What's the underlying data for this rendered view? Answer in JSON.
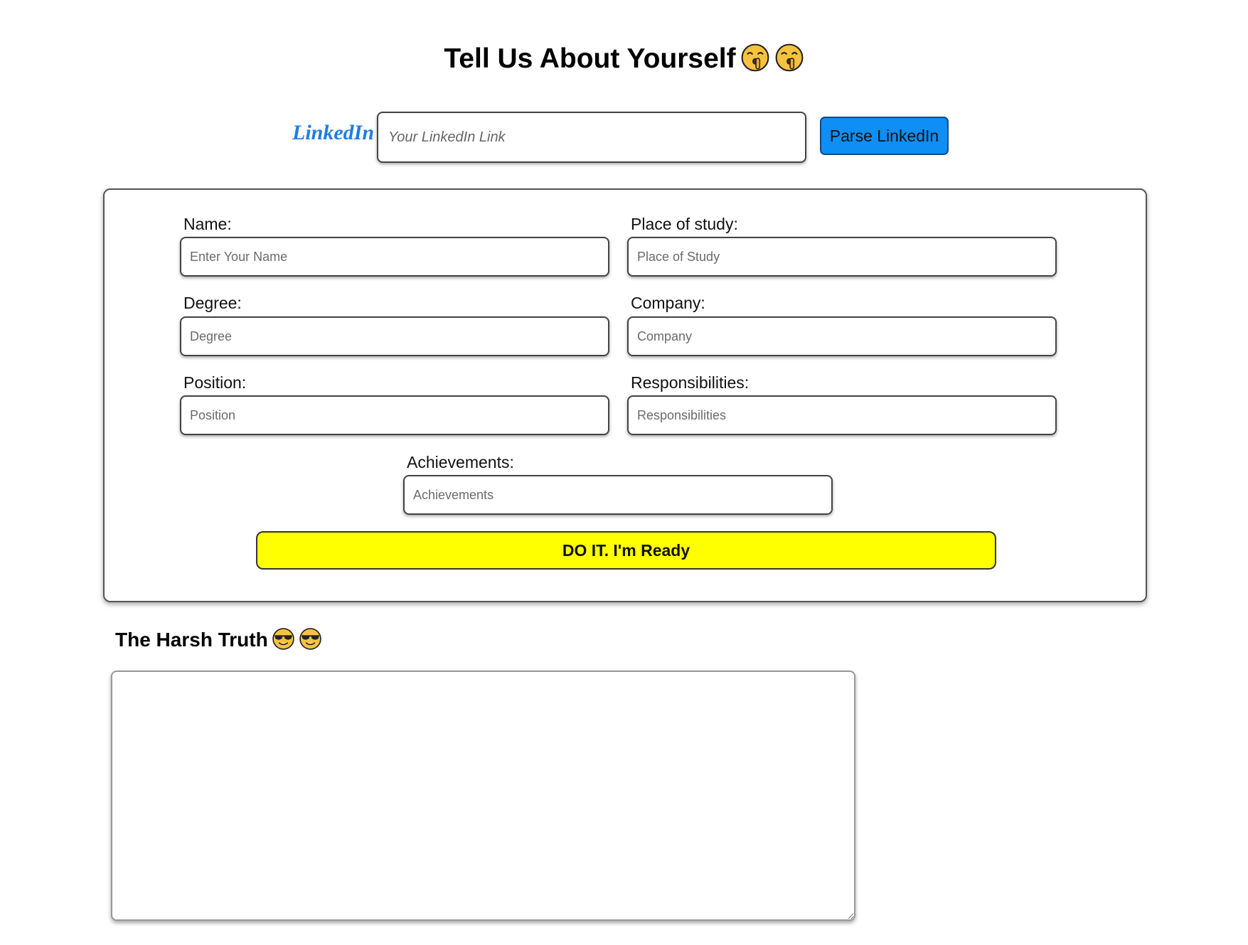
{
  "header": {
    "title": "Tell Us About Yourself",
    "title_emoji": "shushing-face-icon"
  },
  "linkedin": {
    "label": "LinkedIn",
    "placeholder": "Your LinkedIn Link",
    "value": "",
    "button_label": "Parse LinkedIn",
    "button_color": "#0f8ef5",
    "label_color": "#1e7ee0"
  },
  "form": {
    "fields": {
      "name": {
        "label": "Name:",
        "placeholder": "Enter Your Name",
        "value": ""
      },
      "place_of_study": {
        "label": "Place of study:",
        "placeholder": "Place of Study",
        "value": ""
      },
      "degree": {
        "label": "Degree:",
        "placeholder": "Degree",
        "value": ""
      },
      "company": {
        "label": "Company:",
        "placeholder": "Company",
        "value": ""
      },
      "position": {
        "label": "Position:",
        "placeholder": "Position",
        "value": ""
      },
      "responsibilities": {
        "label": "Responsibilities:",
        "placeholder": "Responsibilities",
        "value": ""
      },
      "achievements": {
        "label": "Achievements:",
        "placeholder": "Achievements",
        "value": ""
      }
    },
    "submit_label": "DO IT. I'm Ready",
    "submit_color": "#ffff00"
  },
  "result": {
    "title": "The Harsh Truth",
    "title_emoji": "sunglasses-face-icon",
    "text": ""
  }
}
